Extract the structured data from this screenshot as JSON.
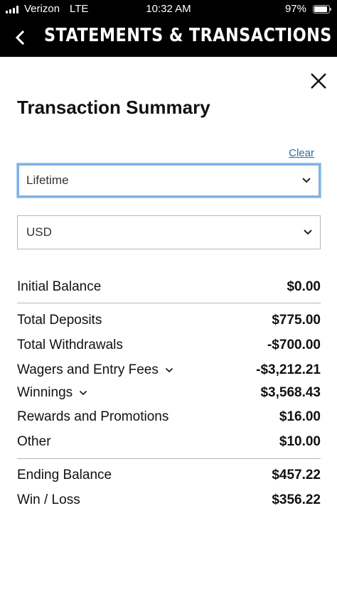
{
  "status_bar": {
    "carrier": "Verizon",
    "network": "LTE",
    "time": "10:32 AM",
    "battery_percent": "97%",
    "battery_level": 0.97,
    "signal_bars": 4
  },
  "header": {
    "title": "STATEMENTS & TRANSACTIONS",
    "back_icon": "chevron-left-icon"
  },
  "panel": {
    "title": "Transaction Summary",
    "close_icon": "close-icon",
    "clear_label": "Clear"
  },
  "filters": {
    "period": "Lifetime",
    "currency": "USD"
  },
  "summary": {
    "initial": {
      "label": "Initial Balance",
      "value": "$0.00"
    },
    "deposits": {
      "label": "Total Deposits",
      "value": "$775.00"
    },
    "withdrawals": {
      "label": "Total Withdrawals",
      "value": "-$700.00"
    },
    "wagers": {
      "label": "Wagers and Entry Fees",
      "value": "-$3,212.21"
    },
    "winnings": {
      "label": "Winnings",
      "value": "$3,568.43"
    },
    "rewards": {
      "label": "Rewards and Promotions",
      "value": "$16.00"
    },
    "other": {
      "label": "Other",
      "value": "$10.00"
    },
    "ending": {
      "label": "Ending Balance",
      "value": "$457.22"
    },
    "win_loss": {
      "label": "Win / Loss",
      "value": "$356.22"
    }
  },
  "colors": {
    "header_bg": "#000000",
    "link": "#2a6ea8",
    "focus_ring": "#7fb3e6"
  }
}
